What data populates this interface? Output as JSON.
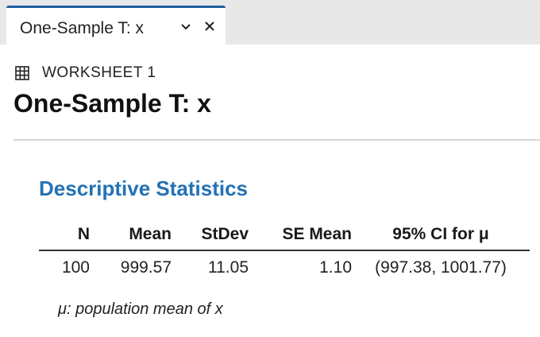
{
  "tab": {
    "title": "One-Sample T: x",
    "chevron_icon": "chevron-down-icon",
    "close_icon": "close-icon"
  },
  "worksheet": {
    "icon": "grid-table-icon",
    "label": "WORKSHEET 1"
  },
  "page_title": "One-Sample T: x",
  "section": {
    "heading": "Descriptive Statistics"
  },
  "table": {
    "headers": [
      "N",
      "Mean",
      "StDev",
      "SE Mean",
      "95% CI for μ"
    ],
    "rows": [
      [
        "100",
        "999.57",
        "11.05",
        "1.10",
        "(997.38, 1001.77)"
      ]
    ]
  },
  "footnote": "μ: population mean of x",
  "colors": {
    "accent": "#1f5fa0",
    "heading": "#2372b5",
    "tab_strip": "#e8e8e8"
  }
}
